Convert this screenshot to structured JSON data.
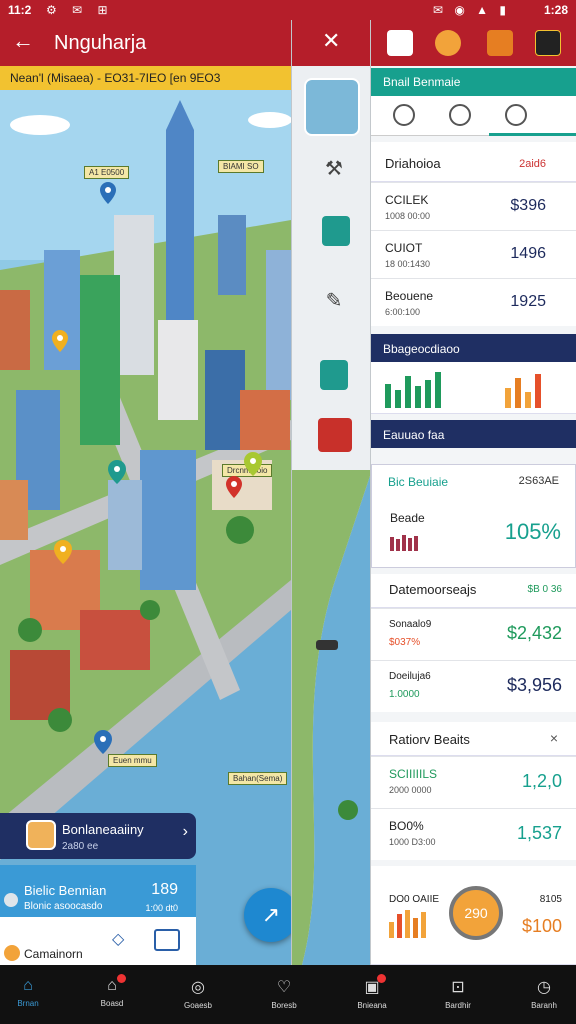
{
  "status": {
    "time": "11:2",
    "right_time": "1:28",
    "left_icons": "⚙ ✉ ⊞",
    "right_icons": "✉ ◉ ▲ ▮"
  },
  "header": {
    "title": "Nnguharja",
    "back_label": "←",
    "close_label": "✕"
  },
  "ticker": {
    "text": "Nean'l (Misaea) - EO31-7IEO  [en 9EO3"
  },
  "map": {
    "tags": [
      "A1 E0500",
      "BIAMI SO",
      "Drcnmoloio",
      "Euen mmu",
      "Bahan(Sema)"
    ]
  },
  "cards": {
    "nav_card": {
      "title": "Bonlaneaaiiny",
      "subtitle": "2a80 ee"
    },
    "info_card": {
      "title": "Bielic Bennian",
      "subtitle": "Blonic asoocasdo",
      "value": "189",
      "value_sub": "1:00 dt0"
    },
    "bottom_card": {
      "title": "Camainorn"
    }
  },
  "right_panel": {
    "teal_header": "Bnail Benmaie",
    "section1_title": "Driahoioa",
    "section1_right": "2aid6",
    "rows": [
      {
        "name": "CCILEK",
        "sub": "1008 00:00",
        "value": "$396",
        "prefix": "nt"
      },
      {
        "name": "CUIOT",
        "sub": "18 00:1430",
        "value": "1496",
        "prefix": "nt"
      },
      {
        "name": "Beouene",
        "sub": "6:00:100",
        "value": "1925",
        "prefix": "nt"
      }
    ],
    "bar1": "Bbageocdiaoo",
    "bar2": "Eauuao faa",
    "sub1_title": "Bic Beuiaie",
    "sub1_right": "2S63AE",
    "sub1_name": "Beade",
    "sub1_value": "105%",
    "sec3_title": "Datemoorseajs",
    "sec3_right": "$B 0 36",
    "sec3_rows": [
      {
        "name": "Sonaalo9",
        "sub": "$037%",
        "value": "$2,432"
      },
      {
        "name": "Doeiluja6",
        "sub": "1.0000",
        "value": "$3,956"
      }
    ],
    "sec4_title": "Ratiorv Beaits",
    "sec4_rows": [
      {
        "name": "SCIIIIILS",
        "sub": "2000 0000",
        "value": "1,2,0"
      },
      {
        "name": "BO0%",
        "sub": "1000 D3:00",
        "value": "1,537"
      }
    ],
    "gauge": "290",
    "foot_left": "DO0 OAIIE",
    "foot_right": "$100",
    "foot_top": "8105"
  },
  "nav": [
    {
      "label": "Brnan",
      "icon": "⌂"
    },
    {
      "label": "Boasd",
      "icon": "⌂"
    },
    {
      "label": "Goaesb",
      "icon": "◎"
    },
    {
      "label": "Boresb",
      "icon": "♡"
    },
    {
      "label": "Bnieana",
      "icon": "▣"
    },
    {
      "label": "Bardhir",
      "icon": "⊡"
    },
    {
      "label": "Baranh",
      "icon": "◷"
    }
  ],
  "colors": {
    "header_red": "#b51e2a",
    "teal": "#17a08e",
    "navy": "#1f2f63"
  }
}
